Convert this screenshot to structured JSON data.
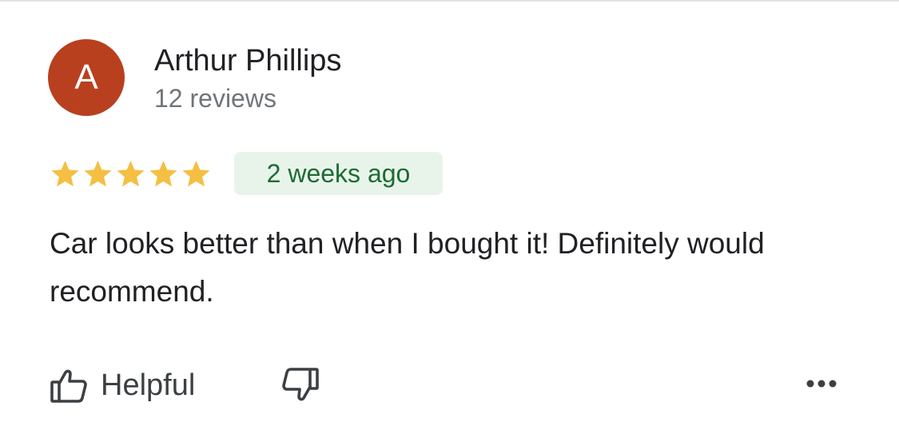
{
  "reviewer": {
    "initial": "A",
    "name": "Arthur Phillips",
    "review_count": "12 reviews",
    "avatar_color": "#b8401f"
  },
  "rating": {
    "stars": 5,
    "max_stars": 5,
    "star_color": "#f4bf42"
  },
  "date_badge": {
    "text": "2 weeks ago",
    "text_color": "#1e6b34",
    "background": "#e8f4ea"
  },
  "review": {
    "text": "Car looks better than when I bought it! Definitely would recommend."
  },
  "actions": {
    "helpful_label": "Helpful",
    "helpful_icon": "thumbs-up-icon",
    "not_helpful_icon": "thumbs-down-icon",
    "more_icon": "more-horizontal-icon",
    "icon_color": "#3c4043"
  }
}
